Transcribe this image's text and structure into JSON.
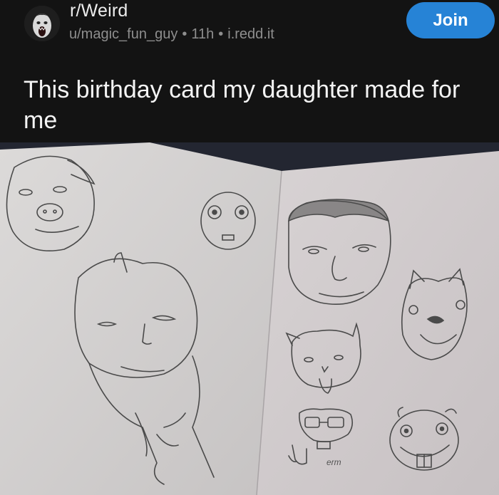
{
  "post": {
    "subreddit": "r/Weird",
    "author": "u/magic_fun_guy",
    "age": "11h",
    "domain": "i.redd.it",
    "separator": "•",
    "title": "This birthday card my daughter made for me"
  },
  "actions": {
    "join_label": "Join"
  },
  "image": {
    "handwritten_text": "erm"
  },
  "colors": {
    "background": "#131313",
    "join_button": "#2683d6",
    "meta_text": "#8e8e8e"
  }
}
